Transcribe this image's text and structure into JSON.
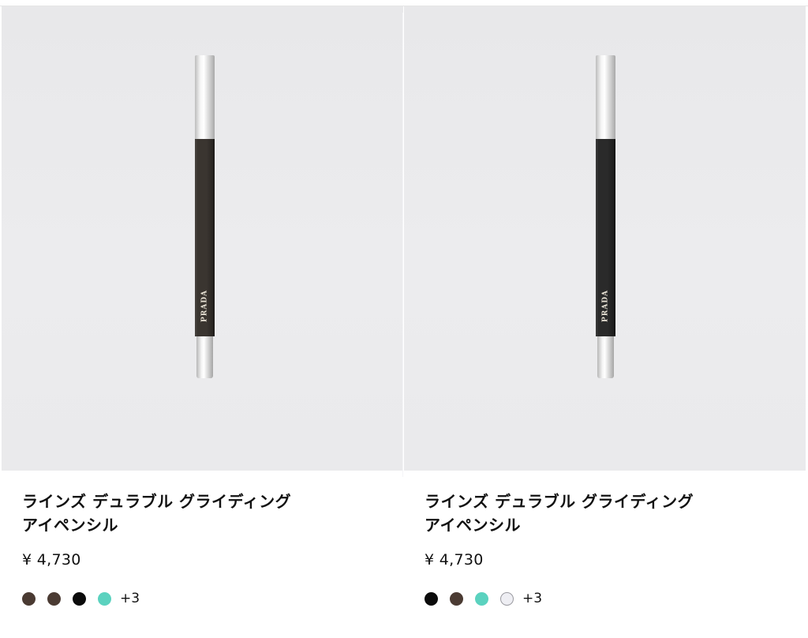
{
  "products": [
    {
      "name_line1": "ラインズ デュラブル グライディング",
      "name_line2": "アイペンシル",
      "price": "¥ 4,730",
      "image": {
        "brand_mark": "PRADA",
        "pencil_body_color": "#3a3530",
        "pencil_cap_color": "#d9d9d9"
      },
      "swatches": [
        {
          "color": "#4a3a32",
          "name": "brown-swatch"
        },
        {
          "color": "#4b3b33",
          "name": "dark-brown-swatch"
        },
        {
          "color": "#0b0b0b",
          "name": "black-swatch"
        },
        {
          "color": "#5bd2bf",
          "name": "turquoise-swatch"
        }
      ],
      "more_colors": "+3"
    },
    {
      "name_line1": "ラインズ デュラブル グライディング",
      "name_line2": "アイペンシル",
      "price": "¥ 4,730",
      "image": {
        "brand_mark": "PRADA",
        "pencil_body_color": "#2a2a2a",
        "pencil_cap_color": "#d9d9d9"
      },
      "swatches": [
        {
          "color": "#0b0b0b",
          "name": "black-swatch"
        },
        {
          "color": "#4b3b33",
          "name": "brown-swatch"
        },
        {
          "color": "#5bd2bf",
          "name": "turquoise-swatch"
        },
        {
          "color": "#eeeeF3",
          "name": "white-swatch"
        }
      ],
      "more_colors": "+3"
    }
  ]
}
